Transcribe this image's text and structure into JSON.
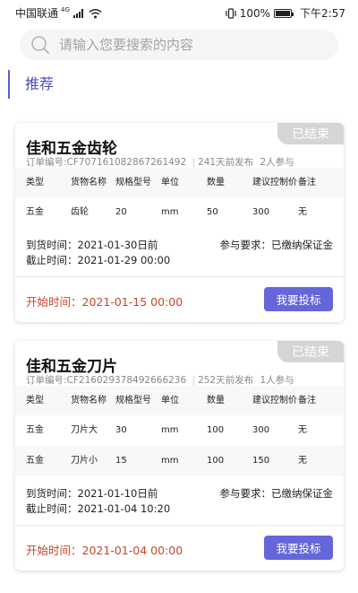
{
  "status_bar": {
    "carrier": "中国联通",
    "network": "4G",
    "battery": "100%",
    "time": "下午2:57"
  },
  "search": {
    "placeholder": "请输入您要搜索的内容"
  },
  "section": {
    "title": "推荐"
  },
  "orders": [
    {
      "status": "已结束",
      "title": "佳和五金齿轮",
      "order_label": "订单编号:",
      "order_no": "CF707161082867261492",
      "published": "241天前发布",
      "participants": "2人参与",
      "columns": [
        "类型",
        "货物名称",
        "规格型号",
        "单位",
        "数量",
        "建议控制价",
        "备注"
      ],
      "rows": [
        [
          "五金",
          "齿轮",
          "20",
          "mm",
          "50",
          "300",
          "无"
        ]
      ],
      "delivery_label": "到货时间：",
      "delivery": "2021-01-30日前",
      "deadline_label": "截止时间：",
      "deadline": "2021-01-29 00:00",
      "requirement": "参与要求：已缴纳保证金",
      "start_label": "开始时间：",
      "start": "2021-01-15 00:00",
      "button": "我要投标"
    },
    {
      "status": "已结束",
      "title": "佳和五金刀片",
      "order_label": "订单编号:",
      "order_no": "CF216029378492666236",
      "published": "252天前发布",
      "participants": "1人参与",
      "columns": [
        "类型",
        "货物名称",
        "规格型号",
        "单位",
        "数量",
        "建议控制价",
        "备注"
      ],
      "rows": [
        [
          "五金",
          "刀片大",
          "30",
          "mm",
          "100",
          "300",
          "无"
        ],
        [
          "五金",
          "刀片小",
          "15",
          "mm",
          "100",
          "150",
          "无"
        ]
      ],
      "delivery_label": "到货时间：",
      "delivery": "2021-01-10日前",
      "deadline_label": "截止时间：",
      "deadline": "2021-01-04 10:20",
      "requirement": "参与要求：已缴纳保证金",
      "start_label": "开始时间：",
      "start": "2021-01-04 00:00",
      "button": "我要投标"
    }
  ]
}
